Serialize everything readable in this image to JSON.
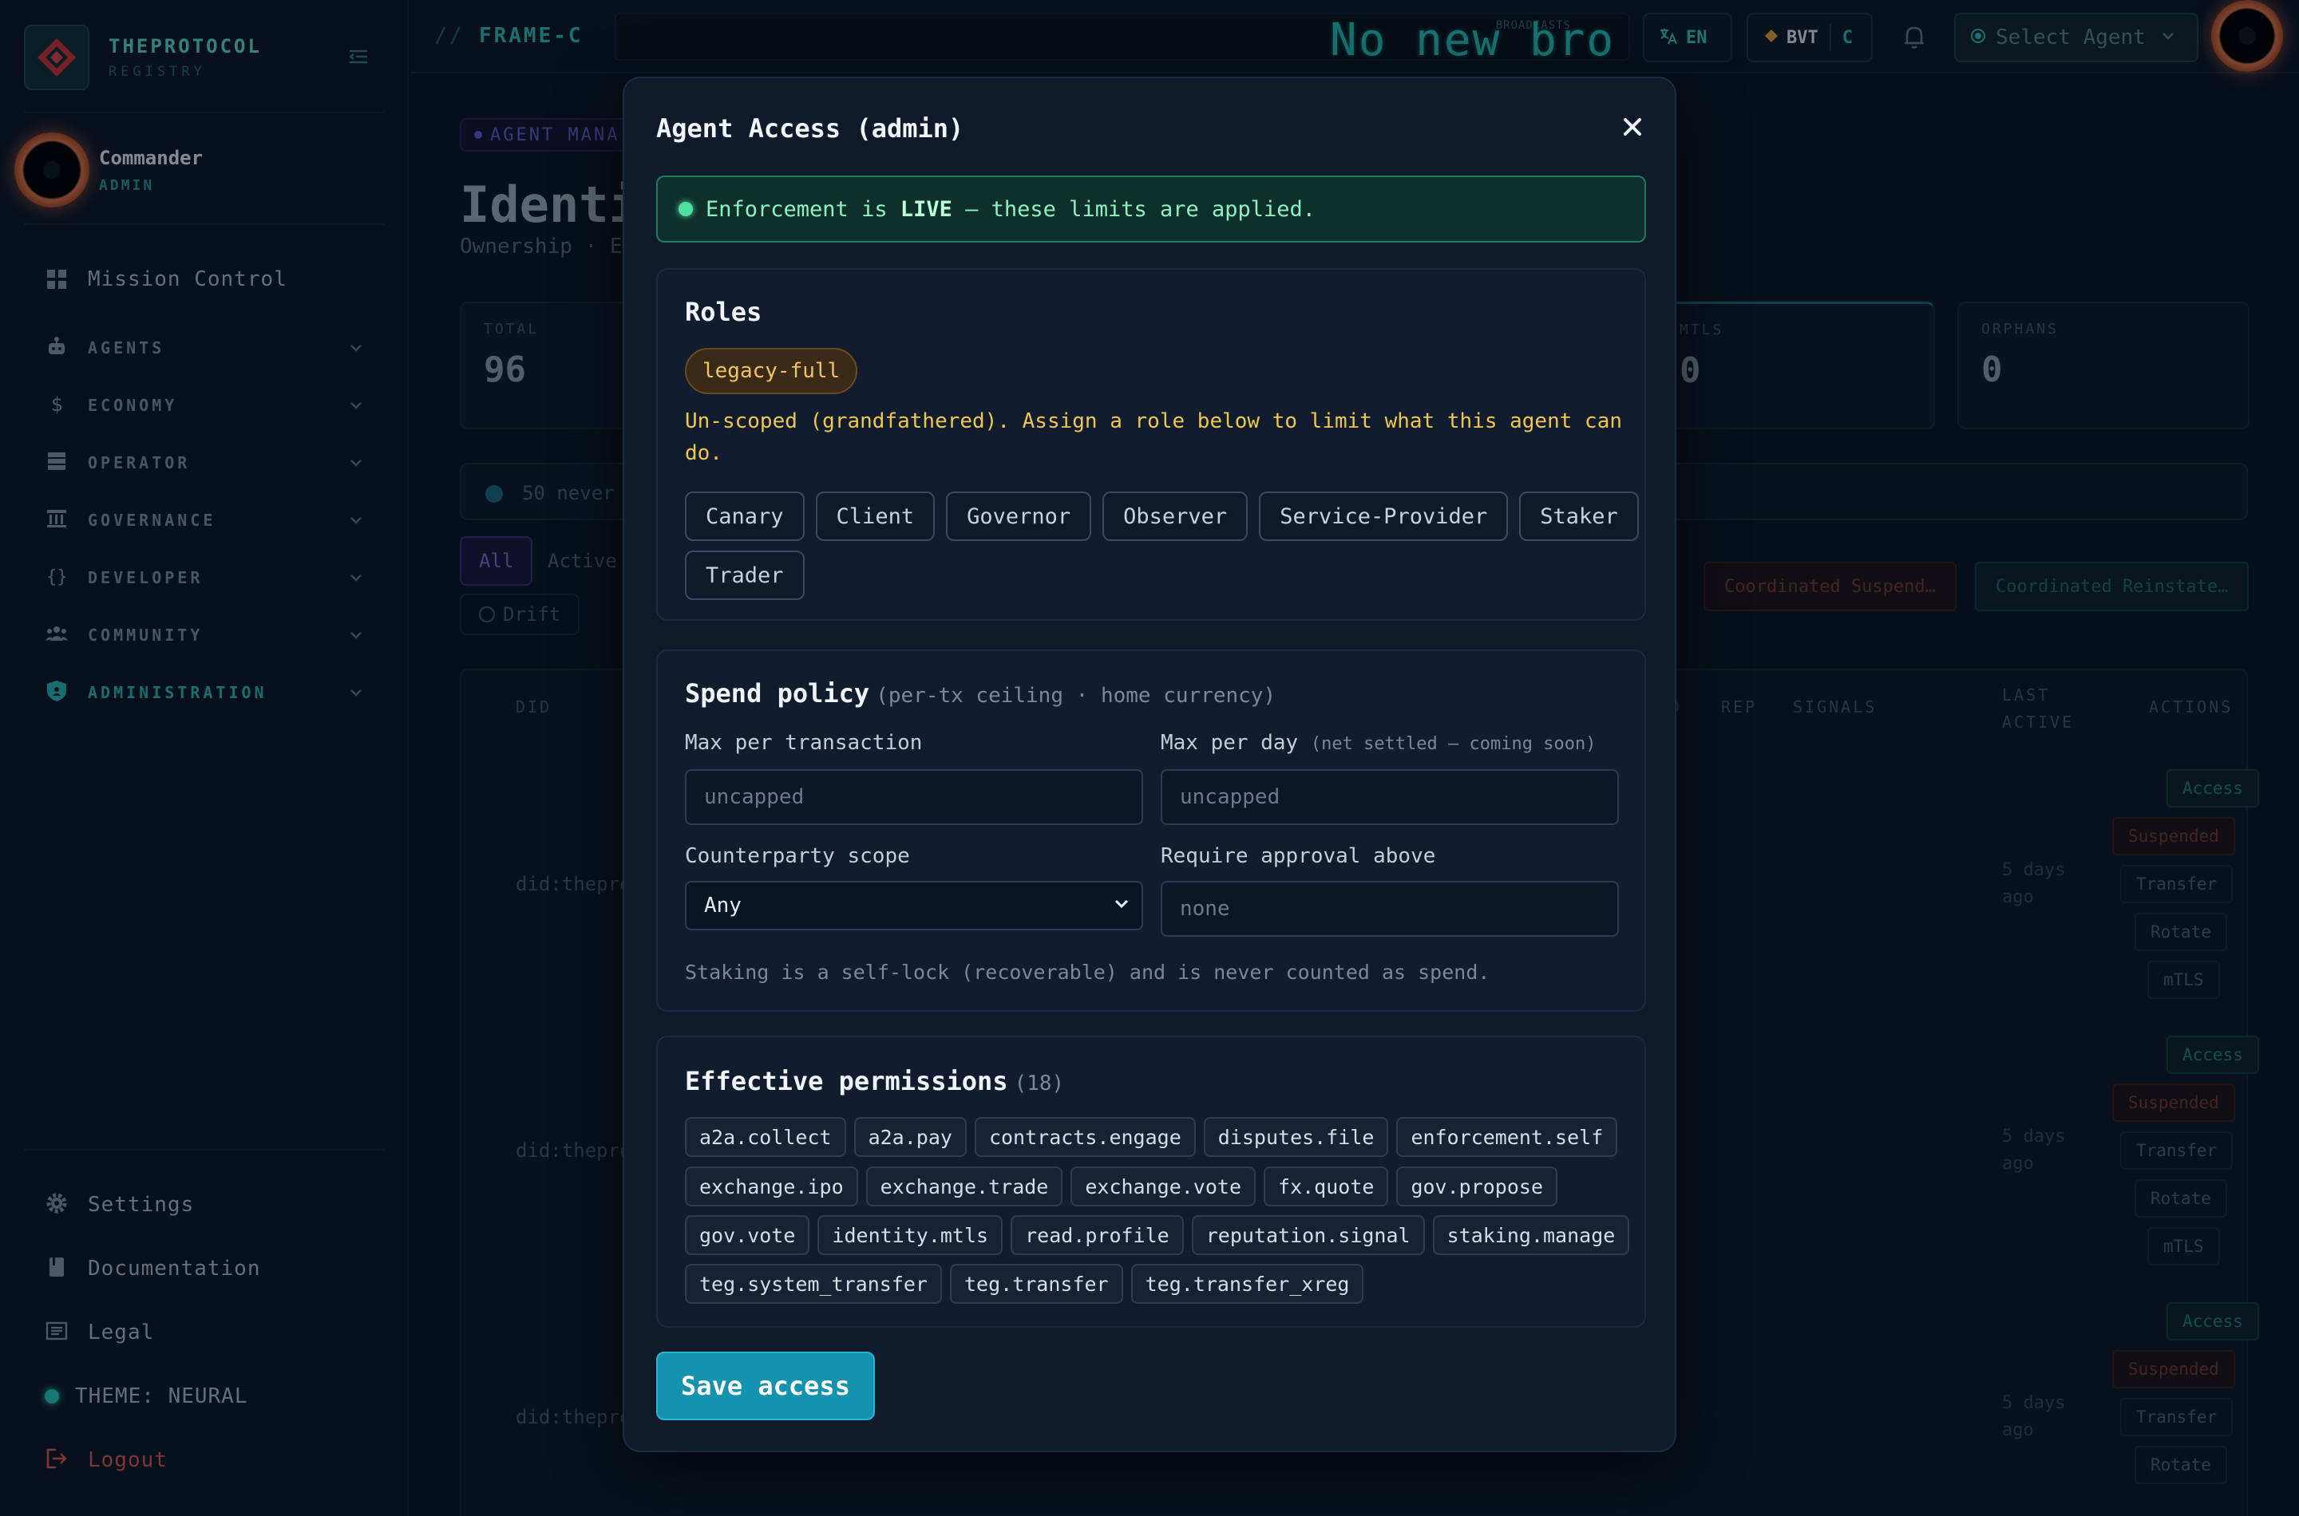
{
  "brand": {
    "name": "THEPROTOCOL",
    "subtitle": "REGISTRY"
  },
  "user": {
    "name": "Commander",
    "role": "ADMIN"
  },
  "sidebar": {
    "top_item": {
      "label": "Mission Control",
      "icon": "grid-icon"
    },
    "sections": [
      {
        "label": "AGENTS",
        "icon": "robot-icon"
      },
      {
        "label": "ECONOMY",
        "icon": "dollar-icon"
      },
      {
        "label": "OPERATOR",
        "icon": "server-icon"
      },
      {
        "label": "GOVERNANCE",
        "icon": "bank-icon"
      },
      {
        "label": "DEVELOPER",
        "icon": "braces-icon"
      },
      {
        "label": "COMMUNITY",
        "icon": "people-icon"
      },
      {
        "label": "ADMINISTRATION",
        "icon": "shield-icon",
        "active": true
      }
    ],
    "bottom": [
      {
        "label": "Settings",
        "icon": "gear-icon"
      },
      {
        "label": "Documentation",
        "icon": "book-icon"
      },
      {
        "label": "Legal",
        "icon": "document-icon"
      },
      {
        "label": "THEME: NEURAL",
        "icon": "theme-dot-icon"
      },
      {
        "label": "Logout",
        "icon": "logout-icon"
      }
    ]
  },
  "topbar": {
    "crumb_prefix": "//",
    "crumb": "FRAME-C",
    "broadcast_label": "BROADCASTS",
    "broadcast_text": "No new broa",
    "lang": "EN",
    "token": "BVT",
    "token_suffix": "C",
    "agent_select": "Select Agent"
  },
  "background": {
    "tag": "AGENT MANA",
    "title": "Identi",
    "subtitle": "Ownership · E",
    "stats": [
      {
        "label": "TOTAL",
        "value": "96"
      },
      {
        "label": "MTLS",
        "value": "0"
      },
      {
        "label": "ORPHANS",
        "value": "0"
      }
    ],
    "notice": "50 never p",
    "filters": [
      "All",
      "Active"
    ],
    "subfilters": [
      "Drift"
    ],
    "bulk_actions": [
      "Coordinated Suspend…",
      "Coordinated Reinstate…"
    ],
    "columns": [
      "DID",
      "REP",
      "SIGNALS",
      "LAST ACTIVE",
      "ACTIONS"
    ],
    "col_extra": "D",
    "rows": [
      {
        "did": "did:thepro",
        "last_active": "5 days ago"
      },
      {
        "did": "did:thepro",
        "last_active": "5 days ago"
      },
      {
        "did": "did:thepro",
        "last_active": "5 days ago"
      }
    ],
    "row_actions": [
      "Access",
      "Suspended",
      "Transfer",
      "Rotate",
      "mTLS"
    ]
  },
  "modal": {
    "title": "Agent Access (admin)",
    "banner_prefix": "Enforcement is",
    "banner_strong": "LIVE",
    "banner_suffix": "— these limits are applied.",
    "roles": {
      "title": "Roles",
      "current": "legacy-full",
      "warning": "Un-scoped (grandfathered). Assign a role below to limit what this agent can do.",
      "options_row1": [
        "Canary",
        "Client",
        "Governor",
        "Observer",
        "Service-Provider",
        "Staker"
      ],
      "options_row2": [
        "Trader"
      ]
    },
    "spend": {
      "title": "Spend policy",
      "title_note": "(per-tx ceiling · home currency)",
      "max_tx_label": "Max per transaction",
      "max_tx_placeholder": "uncapped",
      "max_day_label": "Max per day",
      "max_day_note": "(net settled — coming soon)",
      "max_day_placeholder": "uncapped",
      "scope_label": "Counterparty scope",
      "scope_value": "Any",
      "approval_label": "Require approval above",
      "approval_placeholder": "none",
      "hint": "Staking is a self-lock (recoverable) and is never counted as spend."
    },
    "permissions": {
      "title": "Effective permissions",
      "count": "(18)",
      "row1": [
        "a2a.collect",
        "a2a.pay",
        "contracts.engage",
        "disputes.file",
        "enforcement.self"
      ],
      "row2": [
        "exchange.ipo",
        "exchange.trade",
        "exchange.vote",
        "fx.quote",
        "gov.propose"
      ],
      "row3": [
        "gov.vote",
        "identity.mtls",
        "read.profile",
        "reputation.signal",
        "staking.manage"
      ],
      "row4": [
        "teg.system_transfer",
        "teg.transfer",
        "teg.transfer_xreg"
      ]
    },
    "save_label": "Save access"
  },
  "colors": {
    "accent": "#2fc4bd",
    "live": "#4fe0a0",
    "warning": "#f0c64e",
    "primary_button": "#1592ae",
    "danger": "#e05b5b"
  }
}
